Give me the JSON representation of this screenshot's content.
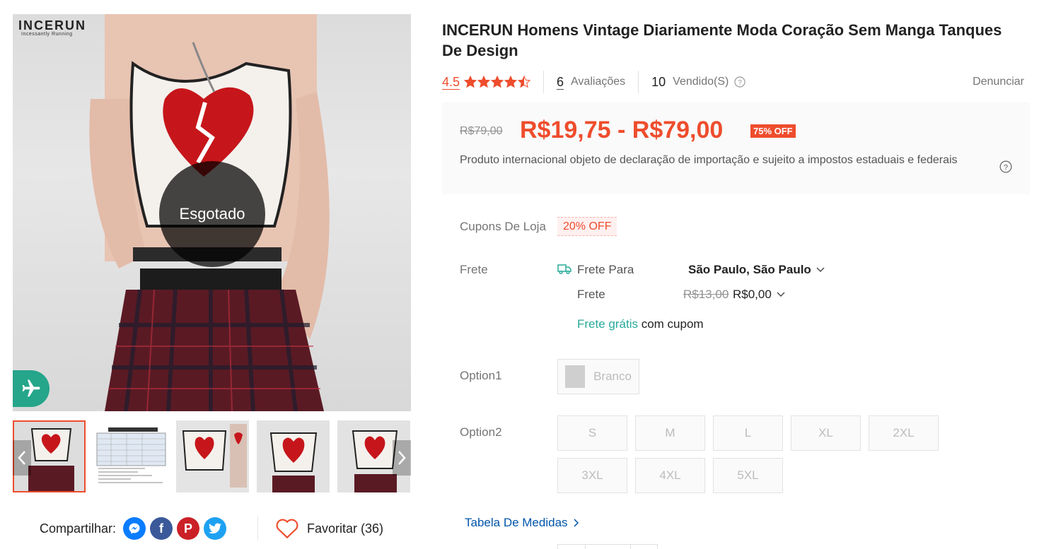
{
  "gallery": {
    "brand_logo": "INCERUN",
    "brand_tagline": "Incessantly Running",
    "soldout_label": "Esgotado"
  },
  "share": {
    "label": "Compartilhar:"
  },
  "favorite": {
    "label": "Favoritar (36)"
  },
  "product": {
    "title": "INCERUN Homens Vintage Diariamente Moda Coração Sem Manga Tanques De Design",
    "rating": "4.5",
    "reviews_count": "6",
    "reviews_label": "Avaliações",
    "sold_count": "10",
    "sold_label": "Vendido(S)",
    "report_label": "Denunciar"
  },
  "price": {
    "original": "R$79,00",
    "current": "R$19,75 - R$79,00",
    "discount": "75% OFF",
    "import_note": "Produto internacional objeto de declaração de importação e sujeito a impostos estaduais e federais"
  },
  "coupons": {
    "label": "Cupons De Loja",
    "tag": "20% OFF"
  },
  "shipping": {
    "label": "Frete",
    "ship_to_label": "Frete Para",
    "ship_to_value": "São Paulo, São Paulo",
    "freight_label": "Frete",
    "freight_old": "R$13,00",
    "freight_value": "R$0,00",
    "free_ship_highlight": "Frete grátis",
    "free_ship_rest": " com cupom"
  },
  "option1": {
    "label": "Option1",
    "values": [
      "Branco"
    ]
  },
  "option2": {
    "label": "Option2",
    "values": [
      "S",
      "M",
      "L",
      "XL",
      "2XL",
      "3XL",
      "4XL",
      "5XL"
    ]
  },
  "size_chart": {
    "label": "Tabela De Medidas"
  },
  "colors": {
    "accent": "#ee4d2d",
    "green": "#26aa99",
    "link": "#0055aa"
  }
}
